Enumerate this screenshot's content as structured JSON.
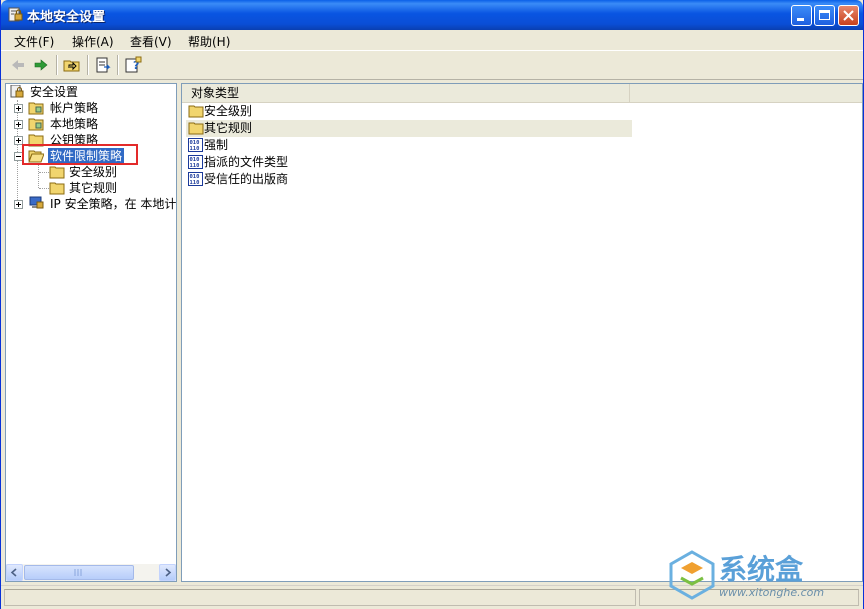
{
  "window": {
    "title": "本地安全设置"
  },
  "menu": {
    "file": "文件(F)",
    "action": "操作(A)",
    "view": "查看(V)",
    "help": "帮助(H)"
  },
  "tree": {
    "root": "安全设置",
    "account_policy": "帐户策略",
    "local_policy": "本地策略",
    "public_key_policy": "公钥策略",
    "software_restriction": "软件限制策略",
    "security_levels": "安全级别",
    "other_rules": "其它规则",
    "ip_security": "IP 安全策略，在 本地计"
  },
  "list": {
    "column_header": "对象类型",
    "items": [
      "安全级别",
      "其它规则",
      "强制",
      "指派的文件类型",
      "受信任的出版商"
    ]
  },
  "watermark": {
    "brand": "系统盒",
    "url": "www.xitonghe.com"
  },
  "colors": {
    "titlebar": "#0a4ed6",
    "selection": "#316ac5",
    "highlight_box": "#e32a2a"
  }
}
